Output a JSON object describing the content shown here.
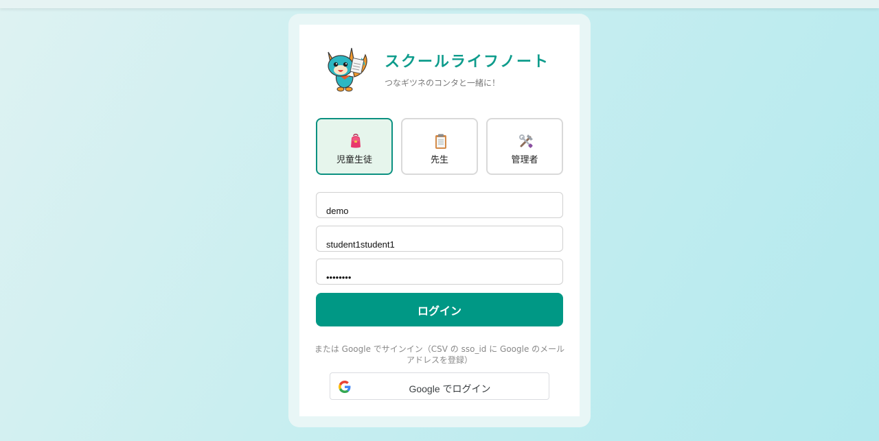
{
  "app": {
    "title": "スクールライフノート",
    "subtitle": "つなギツネのコンタと一緒に！"
  },
  "roles": [
    {
      "label": "児童生徒",
      "icon": "school-bag-icon",
      "selected": true
    },
    {
      "label": "先生",
      "icon": "clipboard-icon",
      "selected": false
    },
    {
      "label": "管理者",
      "icon": "tools-icon",
      "selected": false
    }
  ],
  "form": {
    "school_code_value": "demo",
    "user_id_value": "student1student1",
    "password_value": "student1",
    "login_label": "ログイン"
  },
  "google": {
    "note": "または Google でサインイン（CSV の sso_id に Google のメールアドレスを登録）",
    "button_label": "Google でログイン",
    "icon": "google-g-icon"
  },
  "colors": {
    "accent": "#009885",
    "title": "#0e9c8c",
    "selected_bg": "#e6f5ec"
  }
}
